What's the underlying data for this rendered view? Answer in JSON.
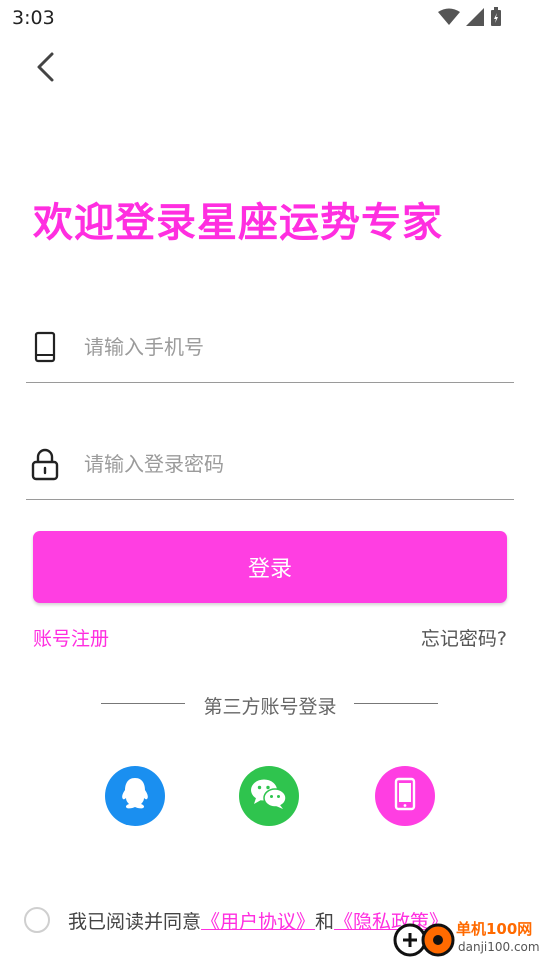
{
  "status_bar": {
    "time": "3:03",
    "icons": [
      "wifi-icon",
      "cell-signal-icon",
      "battery-icon"
    ]
  },
  "nav": {
    "back_icon": "chevron-left-icon"
  },
  "welcome_title": "欢迎登录星座运势专家",
  "form": {
    "phone_placeholder": "请输入手机号",
    "phone_value": "",
    "phone_icon": "phone-icon",
    "password_placeholder": "请输入登录密码",
    "password_value": "",
    "password_icon": "lock-icon",
    "login_label": "登录"
  },
  "links": {
    "register": "账号注册",
    "forgot": "忘记密码?"
  },
  "third_party": {
    "title": "第三方账号登录",
    "providers": [
      "qq-icon",
      "wechat-icon",
      "mobile-icon"
    ]
  },
  "agreement": {
    "prefix": "我已阅读并同意",
    "user_agreement": "《用户协议》",
    "and": "和",
    "privacy_policy": "《隐私政策》",
    "checked": false
  },
  "watermark": {
    "line1": "单机100网",
    "line2": "danji100.com"
  },
  "colors": {
    "accent": "#ff3ee2",
    "qq": "#1a8ff0",
    "wechat": "#2fc44e"
  }
}
